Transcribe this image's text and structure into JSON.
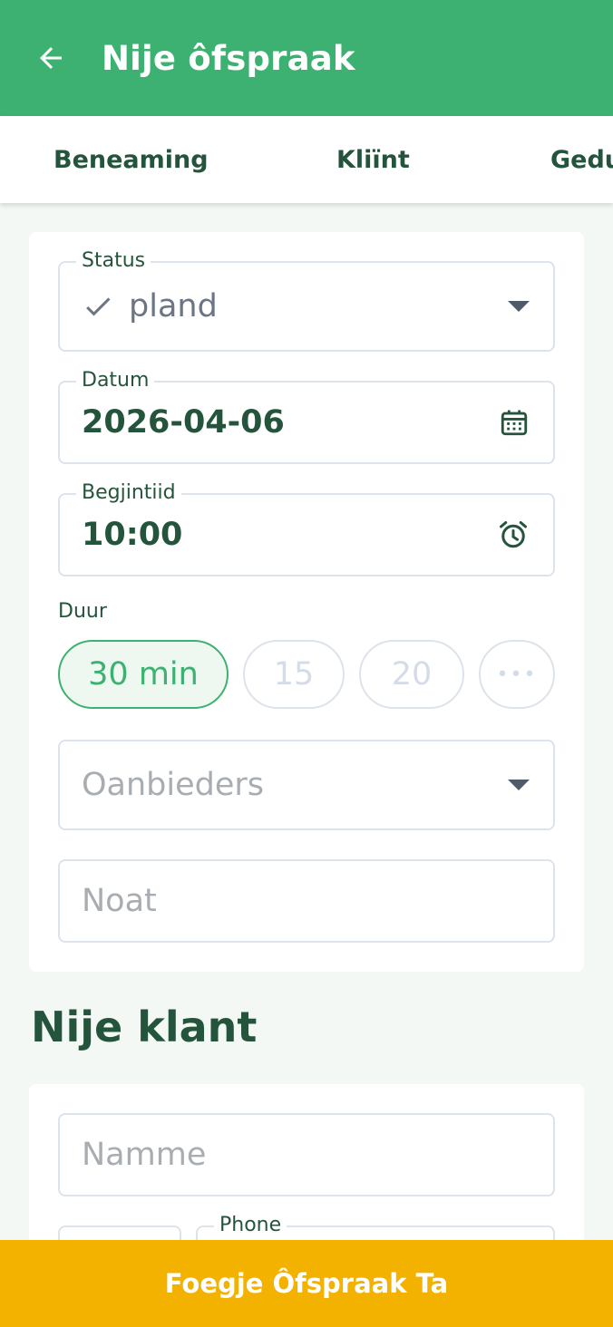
{
  "appbar": {
    "title": "Nije ôfspraak",
    "back_icon": "arrow-left-icon"
  },
  "tabs": [
    {
      "label": "Beneaming"
    },
    {
      "label": "Kliïnt"
    },
    {
      "label": "Gedu"
    }
  ],
  "form": {
    "status": {
      "label": "Status",
      "value": "pland",
      "check_icon": "check-icon",
      "dropdown_icon": "caret-down-icon"
    },
    "date": {
      "label": "Datum",
      "value": "2026-04-06",
      "icon": "calendar-icon"
    },
    "start_time": {
      "label": "Begjintiid",
      "value": "10:00",
      "icon": "alarm-clock-icon"
    },
    "duration": {
      "label": "Duur",
      "options": [
        {
          "label": "30 min",
          "selected": true
        },
        {
          "label": "15",
          "selected": false
        },
        {
          "label": "20",
          "selected": false
        },
        {
          "label": "•••",
          "selected": false
        }
      ]
    },
    "providers": {
      "placeholder": "Oanbieders",
      "dropdown_icon": "caret-down-icon"
    },
    "note": {
      "placeholder": "Noat"
    }
  },
  "new_client": {
    "title": "Nije klant",
    "name": {
      "placeholder": "Namme"
    },
    "phone": {
      "label": "Phone"
    }
  },
  "submit": {
    "label": "Foegje Ôfspraak Ta"
  },
  "colors": {
    "primary": "#3db171",
    "accent": "#f4b200",
    "text_dark": "#24553c",
    "placeholder": "#a8adb2"
  }
}
